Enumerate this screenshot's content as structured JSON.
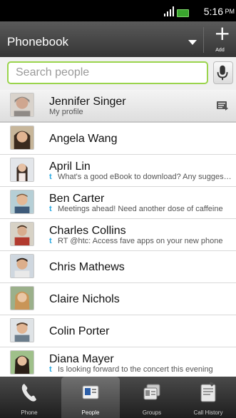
{
  "status_bar": {
    "time": "5:16",
    "ampm": "PM"
  },
  "header": {
    "title": "Phonebook",
    "add_label": "Add"
  },
  "search": {
    "placeholder": "Search people"
  },
  "contacts": [
    {
      "name": "Jennifer Singer",
      "sub": "My profile"
    },
    {
      "name": "Angela Wang"
    },
    {
      "name": "April Lin",
      "sub": "What's a good eBook to download? Any suggestions?"
    },
    {
      "name": "Ben Carter",
      "sub": "Meetings ahead! Need another dose of caffeine"
    },
    {
      "name": "Charles Collins",
      "sub": "RT @htc: Access fave apps on your new phone"
    },
    {
      "name": "Chris Mathews"
    },
    {
      "name": "Claire Nichols"
    },
    {
      "name": "Colin Porter"
    },
    {
      "name": "Diana Mayer",
      "sub": "Is looking forward to the concert this evening"
    }
  ],
  "tabs": [
    {
      "label": "Phone"
    },
    {
      "label": "People"
    },
    {
      "label": "Groups"
    },
    {
      "label": "Call History"
    }
  ],
  "colors": {
    "accent": "#9ad44c",
    "twitter": "#29a9e1",
    "battery": "#3aa52e"
  }
}
